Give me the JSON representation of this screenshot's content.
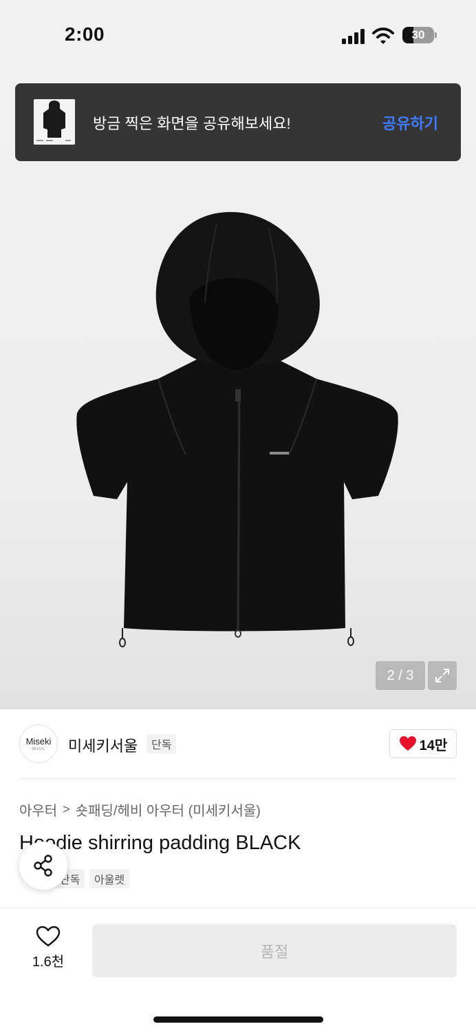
{
  "status_bar": {
    "time": "2:00",
    "battery": "30"
  },
  "toast": {
    "message": "방금 찍은 화면을 공유해보세요!",
    "action_label": "공유하기"
  },
  "gallery": {
    "counter": "2 / 3"
  },
  "brand": {
    "logo_line1": "Miseki",
    "logo_line2": "SEOUL",
    "name": "미세키서울",
    "tag": "단독",
    "like_count": "14만"
  },
  "breadcrumb": {
    "category": "아우터",
    "separator": ">",
    "subcategory": "숏패딩/헤비 아우터 (미세키서울)"
  },
  "product": {
    "title": "Hoodie shirring padding BLACK",
    "tags": [
      "단독",
      "아울렛"
    ]
  },
  "bottom_bar": {
    "wish_count": "1.6천",
    "buy_label": "품절"
  },
  "colors": {
    "toast_bg": "#353535",
    "accent_link": "#3f7bff",
    "heart": "#e8112d",
    "sold_out_bg": "#ececec"
  }
}
